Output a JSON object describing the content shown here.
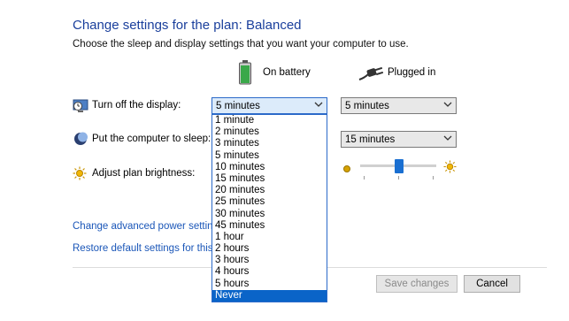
{
  "header": {
    "title": "Change settings for the plan: Balanced",
    "subtitle": "Choose the sleep and display settings that you want your computer to use."
  },
  "columns": {
    "battery_label": "On battery",
    "plugged_label": "Plugged in"
  },
  "rows": {
    "display_label": "Turn off the display:",
    "sleep_label": "Put the computer to sleep:",
    "brightness_label": "Adjust plan brightness:"
  },
  "selects": {
    "display_battery_value": "5 minutes",
    "display_plugged_value": "5 minutes",
    "sleep_plugged_value": "15 minutes"
  },
  "dropdown": {
    "options": [
      "1 minute",
      "2 minutes",
      "3 minutes",
      "5 minutes",
      "10 minutes",
      "15 minutes",
      "20 minutes",
      "25 minutes",
      "30 minutes",
      "45 minutes",
      "1 hour",
      "2 hours",
      "3 hours",
      "4 hours",
      "5 hours",
      "Never"
    ],
    "highlighted": "Never"
  },
  "links": {
    "advanced": "Change advanced power settings",
    "restore": "Restore default settings for this pla"
  },
  "buttons": {
    "save": "Save changes",
    "cancel": "Cancel"
  },
  "brightness": {
    "plugged_level": 0.5
  },
  "colors": {
    "accent": "#0a64c8",
    "title": "#1a3f9c",
    "link": "#1a56b8"
  },
  "icons": [
    "battery-icon",
    "plug-icon",
    "monitor-clock-icon",
    "moon-icon",
    "sun-icon",
    "chevron-down-icon"
  ]
}
